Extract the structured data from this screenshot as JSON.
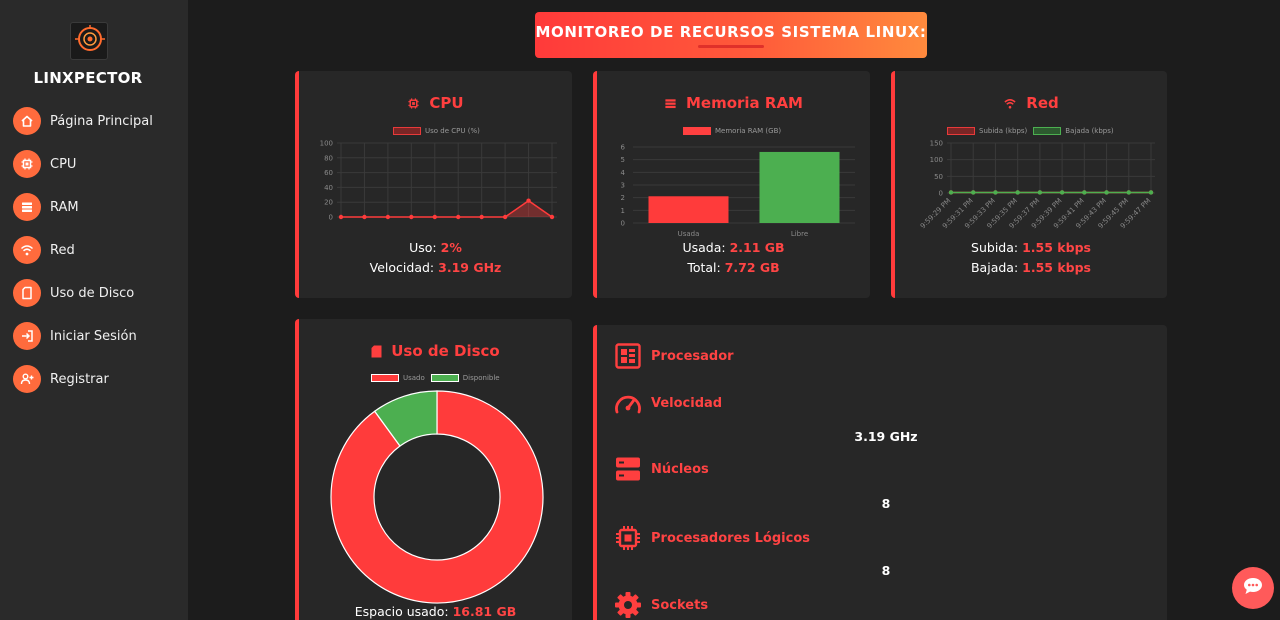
{
  "app": {
    "brand": "LINXPECTOR",
    "logo_text": "LINXPECTOR",
    "accent": "#ff3b3b"
  },
  "sidebar": {
    "items": [
      {
        "label": "Página Principal",
        "icon": "home-icon"
      },
      {
        "label": "CPU",
        "icon": "cpu-icon"
      },
      {
        "label": "RAM",
        "icon": "memory-icon"
      },
      {
        "label": "Red",
        "icon": "wifi-icon"
      },
      {
        "label": "Uso de Disco",
        "icon": "sd-card-icon"
      },
      {
        "label": "Iniciar Sesión",
        "icon": "login-icon"
      },
      {
        "label": "Registrar",
        "icon": "user-plus-icon"
      }
    ]
  },
  "header": {
    "title": "MONITOREO DE RECURSOS SISTEMA LINUX:"
  },
  "cpu": {
    "title": "CPU",
    "legend": "Uso de CPU (%)",
    "usage_label": "Uso:",
    "usage_value": "2%",
    "speed_label": "Velocidad:",
    "speed_value": "3.19 GHz"
  },
  "ram": {
    "title": "Memoria RAM",
    "legend": "Memoria RAM (GB)",
    "used_label": "Usada:",
    "used_value": "2.11 GB",
    "total_label": "Total:",
    "total_value": "7.72 GB"
  },
  "net": {
    "title": "Red",
    "legend_up": "Subida (kbps)",
    "legend_down": "Bajada (kbps)",
    "up_label": "Subida:",
    "up_value": "1.55 kbps",
    "down_label": "Bajada:",
    "down_value": "1.55 kbps"
  },
  "disk": {
    "title": "Uso de Disco",
    "legend_used": "Usado",
    "legend_free": "Disponible",
    "used_label": "Espacio usado:",
    "used_value": "16.81 GB"
  },
  "details": {
    "rows": [
      {
        "label": "Procesador",
        "value": ""
      },
      {
        "label": "Velocidad",
        "value": "3.19 GHz"
      },
      {
        "label": "Núcleos",
        "value": "8"
      },
      {
        "label": "Procesadores Lógicos",
        "value": "8"
      },
      {
        "label": "Sockets",
        "value": ""
      }
    ]
  },
  "chart_data": [
    {
      "type": "line",
      "series": [
        {
          "name": "Uso de CPU (%)",
          "values": [
            0,
            0,
            0,
            0,
            0,
            0,
            0,
            0,
            22,
            0
          ]
        }
      ],
      "ylim": [
        0,
        100
      ],
      "yticks": [
        0,
        20,
        40,
        60,
        80,
        100
      ],
      "color": "#ff3b3b"
    },
    {
      "type": "bar",
      "categories": [
        "Usada",
        "Libre"
      ],
      "series": [
        {
          "name": "Memoria RAM (GB)",
          "values": [
            2.11,
            5.61
          ]
        }
      ],
      "ylim": [
        0,
        6
      ],
      "yticks": [
        0,
        1,
        2,
        3,
        4,
        5,
        6
      ],
      "colors": [
        "#ff3b3b",
        "#4caf50"
      ]
    },
    {
      "type": "line",
      "x": [
        "9:59:29 PM",
        "9:59:31 PM",
        "9:59:33 PM",
        "9:59:35 PM",
        "9:59:37 PM",
        "9:59:39 PM",
        "9:59:41 PM",
        "9:59:43 PM",
        "9:59:45 PM",
        "9:59:47 PM"
      ],
      "series": [
        {
          "name": "Subida (kbps)",
          "values": [
            1.55,
            1.55,
            1.55,
            1.55,
            1.55,
            1.55,
            1.55,
            1.55,
            1.55,
            1.55
          ]
        },
        {
          "name": "Bajada (kbps)",
          "values": [
            1.55,
            1.55,
            1.55,
            1.55,
            1.55,
            1.55,
            1.55,
            1.55,
            1.55,
            1.55
          ]
        }
      ],
      "ylim": [
        0,
        150
      ],
      "yticks": [
        0,
        50,
        100,
        150
      ]
    },
    {
      "type": "pie",
      "categories": [
        "Usado",
        "Disponible"
      ],
      "values": [
        90,
        10
      ],
      "colors": [
        "#ff3b3b",
        "#4caf50"
      ]
    }
  ]
}
